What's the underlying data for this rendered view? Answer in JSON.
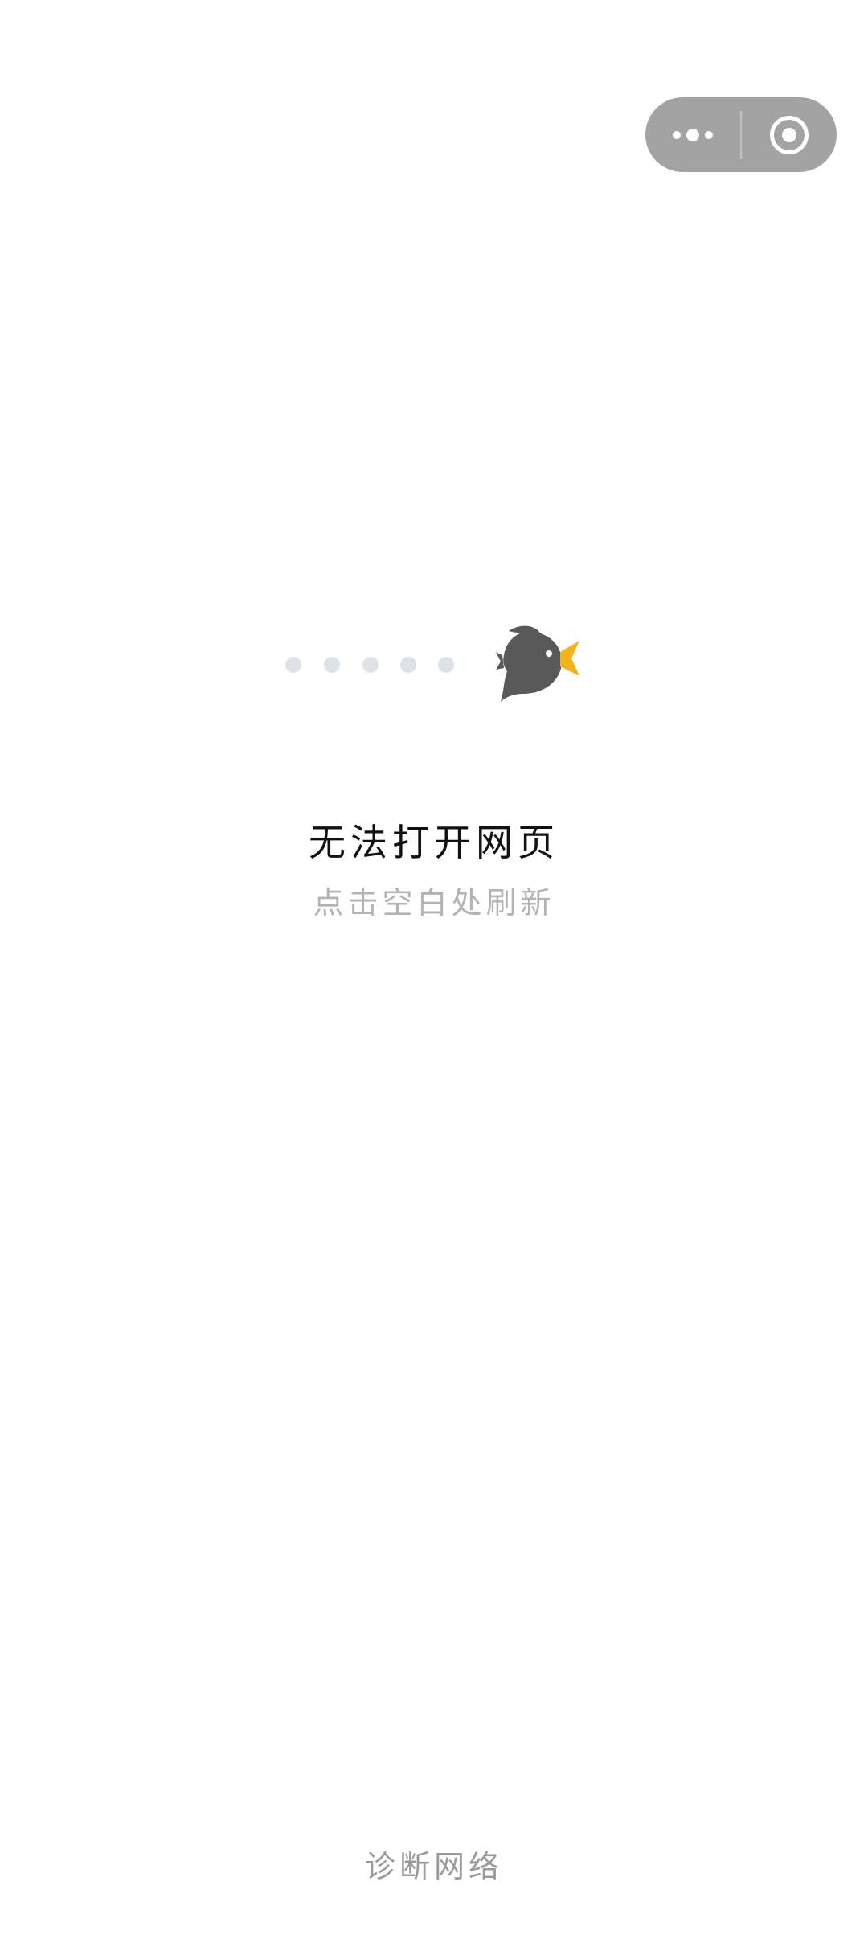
{
  "capsule": {
    "more_icon": "more-dots-icon",
    "close_icon": "target-close-icon"
  },
  "illustration": {
    "icon": "bird-icon",
    "trail_dot_color": "#dde1e8",
    "bird_body_color": "#595959",
    "bird_beak_color": "#f2b21a"
  },
  "error": {
    "title": "无法打开网页",
    "hint": "点击空白处刷新"
  },
  "footer": {
    "diagnose_label": "诊断网络"
  }
}
